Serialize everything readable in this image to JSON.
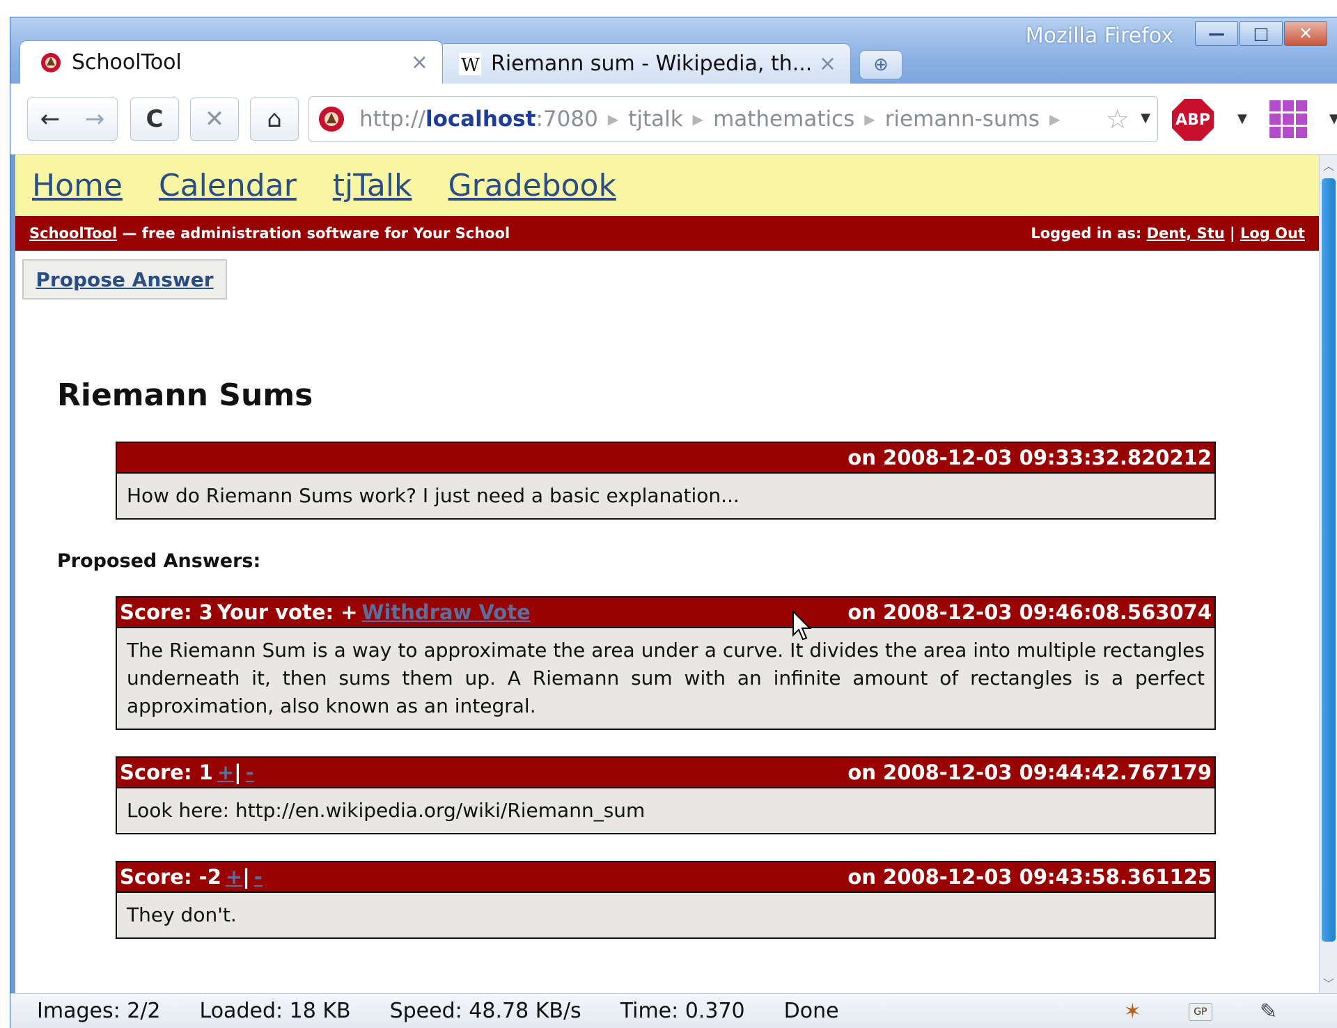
{
  "window": {
    "title": "Mozilla Firefox",
    "controls": {
      "minimize": "—",
      "maximize": "□",
      "close": "✕"
    }
  },
  "tabs": [
    {
      "label": "SchoolTool",
      "close": "×",
      "icon": "schooltool-favicon"
    },
    {
      "label": "Riemann sum - Wikipedia, th...",
      "close": "×",
      "icon": "wikipedia-favicon"
    }
  ],
  "toolbar": {
    "back": "←",
    "forward": "→",
    "reload": "C",
    "stop": "✕",
    "home": "⌂",
    "url_scheme": "http://",
    "url_host": "localhost",
    "url_port": ":7080",
    "breadcrumbs": [
      "tjtalk",
      "mathematics",
      "riemann-sums"
    ],
    "star": "☆",
    "abp_label": "ABP"
  },
  "nav": {
    "home": "Home",
    "calendar": "Calendar",
    "tjtalk": "tjTalk",
    "gradebook": "Gradebook"
  },
  "infobar": {
    "brand": "SchoolTool",
    "tagline": " — free administration software for Your School",
    "logged_prefix": "Logged in as: ",
    "user": "Dent, Stu",
    "separator": " | ",
    "logout": "Log Out"
  },
  "propose_button": "Propose Answer",
  "page_title": "Riemann Sums",
  "question": {
    "timestamp": "on 2008-12-03 09:33:32.820212",
    "body": "How do Riemann Sums work? I just need a basic explanation..."
  },
  "answers_label": "Proposed Answers:",
  "answers": [
    {
      "score": "Score: 3",
      "vote_text": "Your vote: +",
      "withdraw": "Withdraw Vote",
      "timestamp": "on 2008-12-03 09:46:08.563074",
      "body": "The Riemann Sum is a way to approximate the area under a curve. It divides the area into multiple rectangles underneath it, then sums them up. A Riemann sum with an infinite amount of rectangles is a perfect approximation, also known as an integral."
    },
    {
      "score": "Score: 1",
      "up": "+",
      "sep": "|",
      "down": "-",
      "timestamp": "on 2008-12-03 09:44:42.767179",
      "body": "Look here: http://en.wikipedia.org/wiki/Riemann_sum"
    },
    {
      "score": "Score: -2",
      "up": "+",
      "sep": "|",
      "down": "-",
      "timestamp": "on 2008-12-03 09:43:58.361125",
      "body": "They don't."
    }
  ],
  "statusbar": {
    "images": "Images: 2/2",
    "loaded": "Loaded: 18 KB",
    "speed": "Speed: 48.78 KB/s",
    "time": "Time: 0.370",
    "done": "Done",
    "gp": "GP"
  }
}
